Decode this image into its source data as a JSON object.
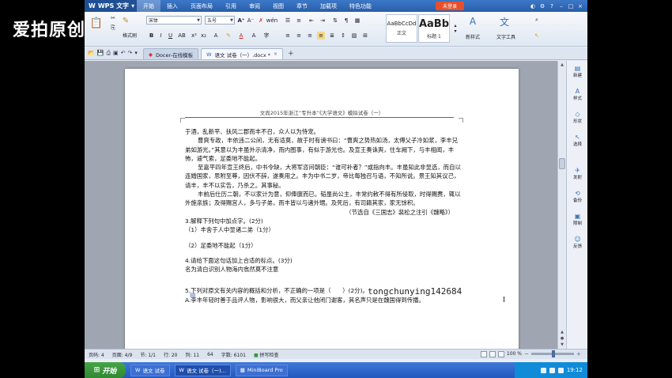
{
  "watermark": "爱拍原创",
  "titlebar": {
    "app_button": "WPS 文字",
    "menus": [
      "开始",
      "插入",
      "页面布局",
      "引用",
      "审阅",
      "视图",
      "章节",
      "加载项",
      "特色功能"
    ],
    "login": "未登录"
  },
  "ribbon": {
    "format_painter": "格式刷",
    "font_name": "宋体",
    "font_size": "五号",
    "styles": [
      {
        "sample": "AaBbCcDd",
        "label": "正文"
      },
      {
        "sample": "AaBb",
        "label": "标题 1"
      }
    ],
    "new_style": "新样式",
    "text_tools": "文字工具"
  },
  "tabs": {
    "tab1": "Docer-在线模板",
    "tab2": "语文 试卷（一）.docx *"
  },
  "document": {
    "header": "文尚2015年浙江“专升本”《大学语文》模拟试卷（一）",
    "paragraphs": [
      "于酒，乱新平、扶风二郡而丰不召，众人以为恃宠。",
      "曹爽专政，丰依违二公间，无有适莫，故于时有谤书曰：“曹爽之势热如汤，太傅父子冷如浆，李丰兄弟如游光。”其意以为丰虽外示清净，而内图事，有似于游光也。及宣王奏诛爽，住车阙下，与丰相闻，丰怖，遽气索，足委地不能起。",
      "至嘉平四年宣王终后，中书令缺，大将军咨问朝臣：“谁可补者？”或指向丰。丰虽知此非显选，而自以连婚国家，思附至尊，因伏不辞，遂奏用之。丰为中书二岁，帝比每独召与语，不知所说。景王知其议己，请丰，丰不以实告，乃杀之。其事秘。",
      "丰前后仕历二朝，不以家计为意，仰俸廪而已。韬虽尚公主，丰常约敕不得有所侵取，时得赐赉，辄以外施亲族；及得赐宫人，多与子弟，而丰皆以与诸外甥。及死后，有司籍其家，家无馀积。"
    ],
    "source": "（节选自《三国志》裴松之注引《魏略》）",
    "q3": "3.解释下列句中加点字。(2分)",
    "q3_1": "（1）丰舍于人中显诸二弟（1分）",
    "q3_2": "（2）足委地不能起（1分）",
    "q4": "4.请给下面这句话加上合适的标点。(3分)",
    "q4_text": "名为清白识别人物海内翕然莫不注意",
    "q5": "5.下列对原文有关内容的概括和分析，不正确的一项是（　　）(2分)。",
    "q5_a": "A.李丰年轻时善于品评人物，影响很大，而父亲让他闭门谢客，其名声只是在魏国得到传播。",
    "overlay": "tongchunying142684"
  },
  "sidepanel": [
    "新建",
    "样式",
    "形状",
    "选择",
    "发射",
    "备份",
    "限制",
    "反馈"
  ],
  "statusbar": {
    "page_no": "页码: 4",
    "page_count": "页面: 4/9",
    "section": "节: 1/1",
    "row": "行: 20",
    "col": "列: 11",
    "value": "64",
    "word_count": "字数: 6101",
    "spell": "拼写检查",
    "zoom": "100 %"
  },
  "taskbar": {
    "start": "开始",
    "tasks": [
      "语文 试卷",
      "语文 试卷（一)...",
      "MiniBoard Pro"
    ],
    "clock": "19:12"
  }
}
